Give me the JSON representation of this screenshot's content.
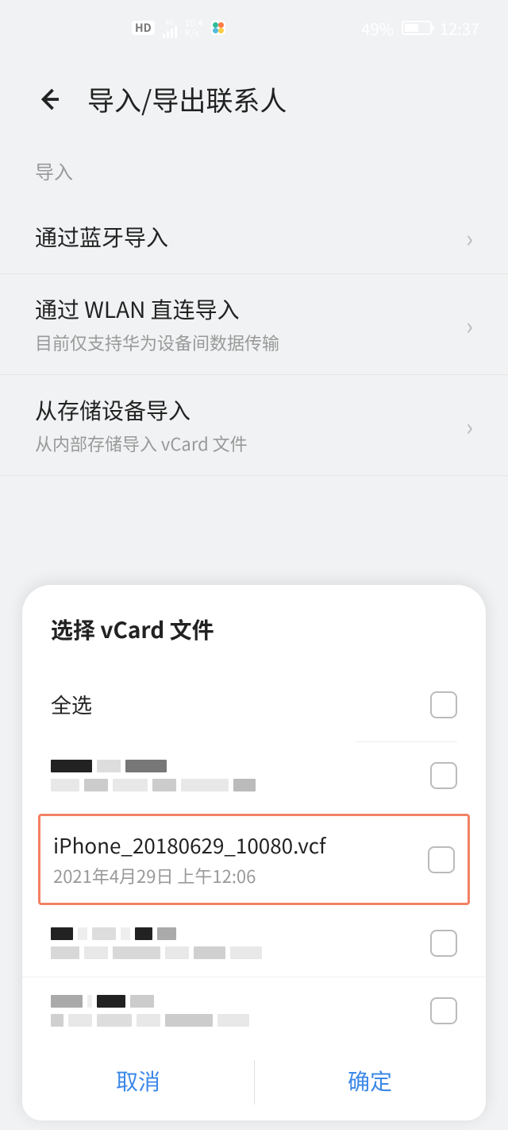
{
  "status": {
    "net_speed_top": "10.4",
    "net_speed_bot": "K/s",
    "batt_pct": "49%",
    "clock": "12:37",
    "net_label": "4G"
  },
  "header": {
    "title": "导入/导出联系人"
  },
  "section": {
    "label": "导入"
  },
  "rows": [
    {
      "title": "通过蓝牙导入",
      "sub": null
    },
    {
      "title": "通过 WLAN 直连导入",
      "sub": "目前仅支持华为设备间数据传输"
    },
    {
      "title": "从存储设备导入",
      "sub": "从内部存储导入 vCard 文件"
    }
  ],
  "sheet": {
    "title": "选择 vCard 文件",
    "select_all": "全选",
    "files": [
      {
        "name": "iPhone_20180629_10080.vcf",
        "date": "2021年4月29日 上午12:06"
      }
    ],
    "cancel": "取消",
    "confirm": "确定"
  }
}
